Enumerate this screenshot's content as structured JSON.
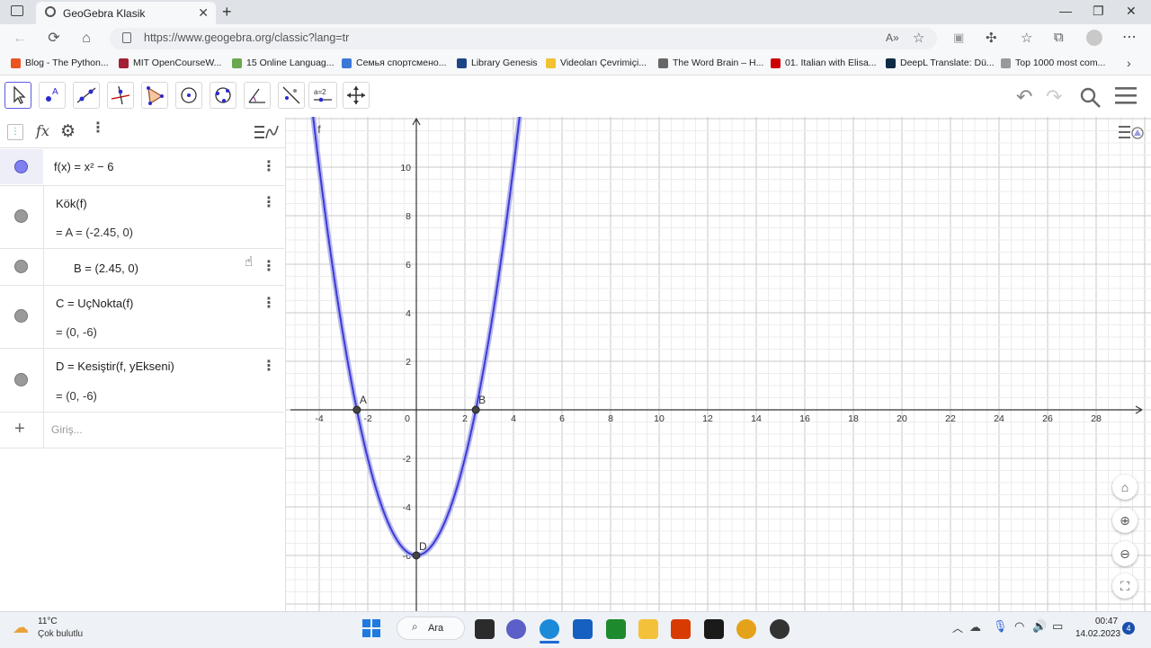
{
  "browser": {
    "tab_title": "GeoGebra Klasik",
    "new_tab": "+",
    "url": "https://www.geogebra.org/classic?lang=tr",
    "bookmarks": [
      {
        "label": "Blog - The Python...",
        "color": "#e95420"
      },
      {
        "label": "MIT OpenCourseW...",
        "color": "#a31f34"
      },
      {
        "label": "15 Online Languag...",
        "color": "#6aa84f"
      },
      {
        "label": "Семья спортсмено...",
        "color": "#3c78d8"
      },
      {
        "label": "Library Genesis",
        "color": "#1c4587"
      },
      {
        "label": "Videoları Çevrimiçi...",
        "color": "#f1c232"
      },
      {
        "label": "The Word Brain – H...",
        "color": "#666666"
      },
      {
        "label": "01. Italian with Elisa...",
        "color": "#cc0000"
      },
      {
        "label": "DeepL Translate: Dü...",
        "color": "#0f2b46"
      },
      {
        "label": "Top 1000 most com...",
        "color": "#999999"
      }
    ]
  },
  "algebra": {
    "f_def": "f(x)  =  x² − 6",
    "root_cmd": "Kök(f)",
    "A_val": "=  A  =  (-2.45, 0)",
    "B_val": "B  =  (2.45, 0)",
    "C_cmd": "C  =  UçNokta(f)",
    "C_val": "=  (0, -6)",
    "D_cmd": "D  =  Kesiştir(f, yEkseni)",
    "D_val": "=  (0, -6)",
    "input_placeholder": "Giriş...",
    "add": "+"
  },
  "graph": {
    "x_ticks": [
      "-4",
      "-2",
      "0",
      "2",
      "4",
      "6",
      "8",
      "10",
      "12",
      "14",
      "16",
      "18",
      "20",
      "22",
      "24",
      "26",
      "28"
    ],
    "y_ticks": [
      "10",
      "8",
      "6",
      "4",
      "2",
      "-2",
      "-4",
      "-6"
    ],
    "function_label": "f",
    "point_labels": {
      "A": "A",
      "B": "B",
      "D": "D"
    },
    "curve_color": "#3b3bd6"
  },
  "taskbar": {
    "temp": "11°C",
    "weather": "Çok bulutlu",
    "search": "Ara",
    "time": "00:47",
    "date": "14.02.2023",
    "notifications": "4"
  }
}
